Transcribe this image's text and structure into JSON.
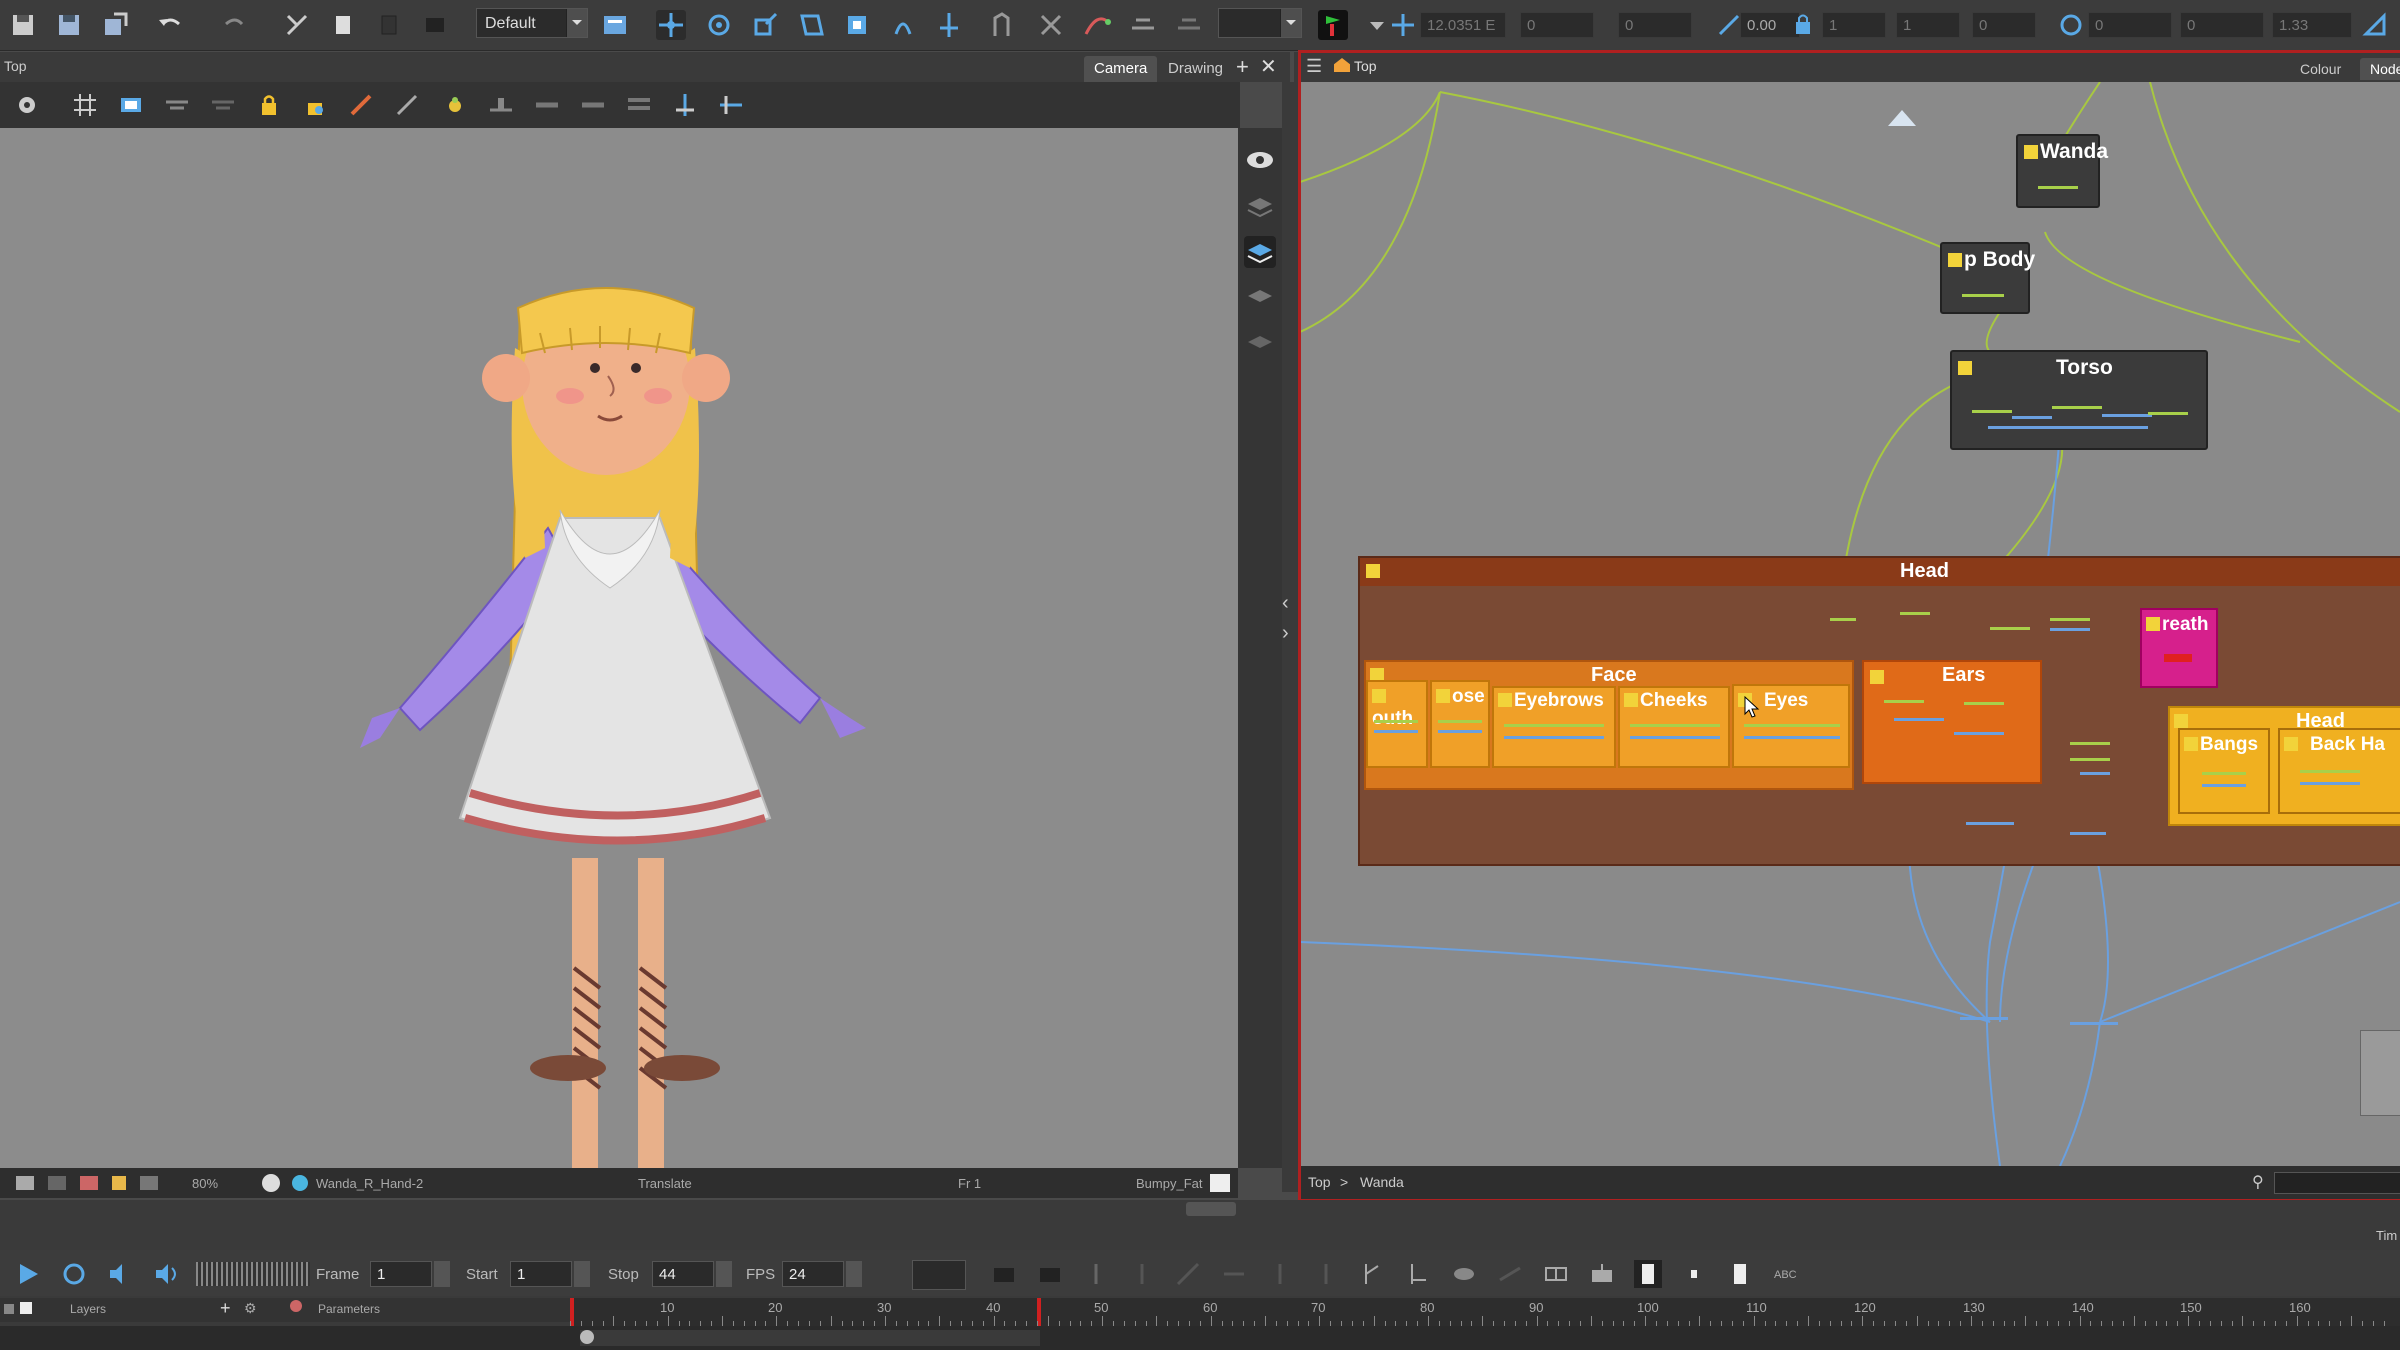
{
  "toolbar": {
    "workspace_combo": "Default",
    "field_rotation": "12.0351 E",
    "field_x": "0",
    "field_y": "0",
    "field_skew": "0.00",
    "field_scale_x": "1",
    "field_scale_y": "1",
    "field_z": "0",
    "field_angle": "0",
    "field_b": "0",
    "field_c": "1.33"
  },
  "camera_view": {
    "title": "Top",
    "tabs": [
      "Camera",
      "Drawing"
    ],
    "status": {
      "zoom": "80%",
      "drawing": "Wanda_R_Hand-2",
      "tool": "Translate",
      "frame": "Fr 1",
      "palette": "Bumpy_Fat"
    }
  },
  "node_view": {
    "breadcrumb_top": "Top",
    "tabs": [
      "Colour",
      "Node"
    ],
    "path_top": "Top",
    "path_sep": ">",
    "path_node": "Wanda",
    "nodes": {
      "wanda": "Wanda",
      "body": "p Body",
      "torso": "Torso",
      "head_group": "Head",
      "face": "Face",
      "mouth": "outh",
      "nose": "ose",
      "eyebrows": "Eyebrows",
      "cheeks": "Cheeks",
      "eyes": "Eyes",
      "ears": "Ears",
      "breath": "reath",
      "head_inner": "Head",
      "bangs": "Bangs",
      "back_hair": "Back Ha"
    }
  },
  "playback": {
    "frame_label": "Frame",
    "frame_value": "1",
    "start_label": "Start",
    "start_value": "1",
    "stop_label": "Stop",
    "stop_value": "44",
    "fps_label": "FPS",
    "fps_value": "24",
    "layers_label": "Layers",
    "parameters_label": "Parameters",
    "tim_label": "Tim"
  },
  "timeline": {
    "ticks": [
      "10",
      "20",
      "30",
      "40",
      "50",
      "60",
      "70",
      "80",
      "90",
      "100",
      "110",
      "120",
      "130",
      "140",
      "150",
      "160"
    ]
  },
  "colors": {
    "accent_red": "#b02020",
    "group_head": "#7a4a34",
    "group_face": "#d9781e",
    "node_breath": "#d6208c"
  }
}
